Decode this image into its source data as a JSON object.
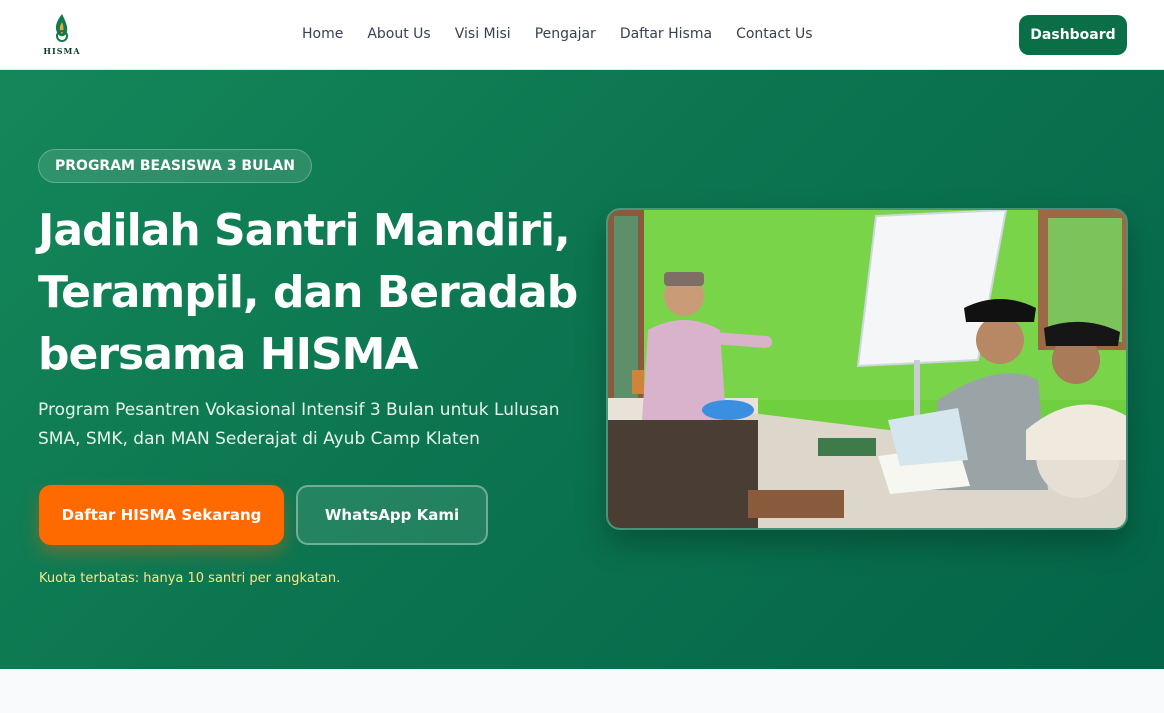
{
  "brand": {
    "logo_text": "HISMA",
    "colors": {
      "primary": "#0a6e47",
      "accent": "#ff6a00",
      "note": "#fde68a"
    }
  },
  "nav": {
    "items": [
      {
        "label": "Home"
      },
      {
        "label": "About Us"
      },
      {
        "label": "Visi Misi"
      },
      {
        "label": "Pengajar"
      },
      {
        "label": "Daftar Hisma"
      },
      {
        "label": "Contact Us"
      }
    ],
    "dashboard_label": "Dashboard"
  },
  "hero": {
    "badge": "PROGRAM BEASISWA 3 BULAN",
    "headline": "Jadilah Santri Mandiri, Terampil, dan Beradab bersama HISMA",
    "subheadline": "Program Pesantren Vokasional Intensif 3 Bulan untuk Lulusan SMA, SMK, dan MAN Sederajat di Ayub Camp Klaten",
    "primary_cta": "Daftar HISMA Sekarang",
    "secondary_cta": "WhatsApp Kami",
    "note": "Kuota terbatas: hanya 10 santri per angkatan.",
    "image_icon": "classroom-photo"
  }
}
